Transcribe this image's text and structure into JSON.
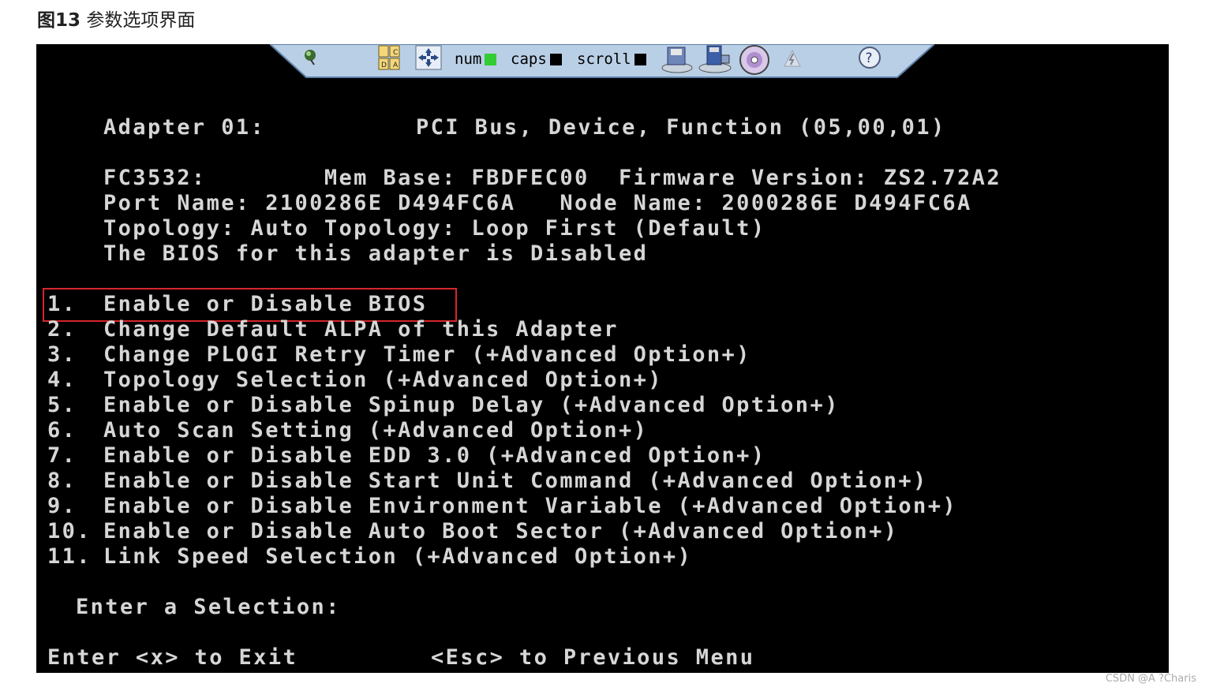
{
  "caption": {
    "number": "图13",
    "text": "参数选项界面"
  },
  "toolbar": {
    "num_label": "num",
    "caps_label": "caps",
    "scroll_label": "scroll",
    "colors": {
      "bar": "#b9cfe6",
      "num_led": "#33cc33",
      "caps_led": "#000000",
      "scroll_led": "#000000"
    }
  },
  "screen": {
    "adapter_label": "Adapter 01:",
    "pci_info": "PCI Bus, Device, Function (05,00,01)",
    "info_lines": [
      "FC3532:        Mem Base: FBDFEC00  Firmware Version: ZS2.72A2",
      "Port Name: 2100286E D494FC6A   Node Name: 2000286E D494FC6A",
      "Topology: Auto Topology: Loop First (Default)",
      "The BIOS for this adapter is Disabled"
    ],
    "menu": [
      {
        "num": "1.",
        "text": "Enable or Disable BIOS"
      },
      {
        "num": "2.",
        "text": "Change Default ALPA of this Adapter"
      },
      {
        "num": "3.",
        "text": "Change PLOGI Retry Timer (+Advanced Option+)"
      },
      {
        "num": "4.",
        "text": "Topology Selection (+Advanced Option+)"
      },
      {
        "num": "5.",
        "text": "Enable or Disable Spinup Delay (+Advanced Option+)"
      },
      {
        "num": "6.",
        "text": "Auto Scan Setting (+Advanced Option+)"
      },
      {
        "num": "7.",
        "text": "Enable or Disable EDD 3.0 (+Advanced Option+)"
      },
      {
        "num": "8.",
        "text": "Enable or Disable Start Unit Command (+Advanced Option+)"
      },
      {
        "num": "9.",
        "text": "Enable or Disable Environment Variable (+Advanced Option+)"
      },
      {
        "num": "10.",
        "text": "Enable or Disable Auto Boot Sector (+Advanced Option+)"
      },
      {
        "num": "11.",
        "text": "Link Speed Selection (+Advanced Option+)"
      }
    ],
    "prompt": "Enter a Selection:",
    "exit_hint": "Enter <x> to Exit",
    "prev_hint": "<Esc> to Previous Menu",
    "highlight_color": "#d6262a"
  },
  "watermark": "CSDN @A ?Charis"
}
